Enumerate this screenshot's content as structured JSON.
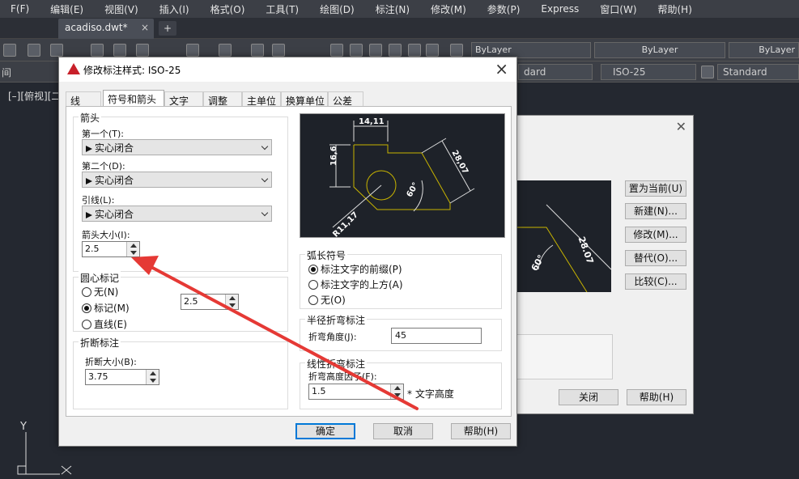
{
  "app": {
    "menu": [
      "F(F)",
      "编辑(E)",
      "视图(V)",
      "插入(I)",
      "格式(O)",
      "工具(T)",
      "绘图(D)",
      "标注(N)",
      "修改(M)",
      "参数(P)",
      "Express",
      "窗口(W)",
      "帮助(H)"
    ],
    "doc_tab": "acadiso.dwt*",
    "doc_tab_close": "×",
    "new_tab": "+",
    "bylayer_1": "ByLayer",
    "bylayer_2": "ByLayer",
    "bylayer_3": "ByLayer",
    "combo_dard": "dard",
    "combo_iso": "ISO-25",
    "combo_standard": "Standard",
    "partial_left": "间",
    "viewport_label": "[–][俯视][二"
  },
  "bg_dialog": {
    "buttons": [
      "置为当前(U)",
      "新建(N)...",
      "修改(M)...",
      "替代(O)...",
      "比较(C)..."
    ],
    "close": "关闭",
    "help": "帮助(H)",
    "dim_text": "28.07",
    "angle_text": "60°"
  },
  "dialog": {
    "title": "修改标注样式: ISO-25",
    "close": "×",
    "tabs": [
      "线",
      "符号和箭头",
      "文字",
      "调整",
      "主单位",
      "换算单位",
      "公差"
    ],
    "arrows": {
      "title": "箭头",
      "first_label": "第一个(T):",
      "first_value": "实心闭合",
      "second_label": "第二个(D):",
      "second_value": "实心闭合",
      "leader_label": "引线(L):",
      "leader_value": "实心闭合",
      "size_label": "箭头大小(I):",
      "size_value": "2.5"
    },
    "center_marks": {
      "title": "圆心标记",
      "none": "无(N)",
      "mark": "标记(M)",
      "line": "直线(E)",
      "value": "2.5"
    },
    "break": {
      "title": "折断标注",
      "size_label": "折断大小(B):",
      "size_value": "3.75"
    },
    "preview": {
      "dim_top": "14,11",
      "dim_left": "16,6",
      "dim_right": "28,07",
      "angle": "60°",
      "radius": "R11,17"
    },
    "arc": {
      "title": "弧长符号",
      "opt1": "标注文字的前缀(P)",
      "opt2": "标注文字的上方(A)",
      "opt3": "无(O)"
    },
    "radius_jog": {
      "title": "半径折弯标注",
      "angle_label": "折弯角度(J):",
      "angle_value": "45"
    },
    "linear_jog": {
      "title": "线性折弯标注",
      "factor_label": "折弯高度因子(F):",
      "factor_value": "1.5",
      "suffix": "* 文字高度"
    },
    "buttons": {
      "ok": "确定",
      "cancel": "取消",
      "help": "帮助(H)"
    }
  },
  "axis": {
    "y": "Y"
  },
  "colors": {
    "accent": "#0078d7",
    "annotation_arrow": "#e53935",
    "preview_line": "#c8b400"
  }
}
